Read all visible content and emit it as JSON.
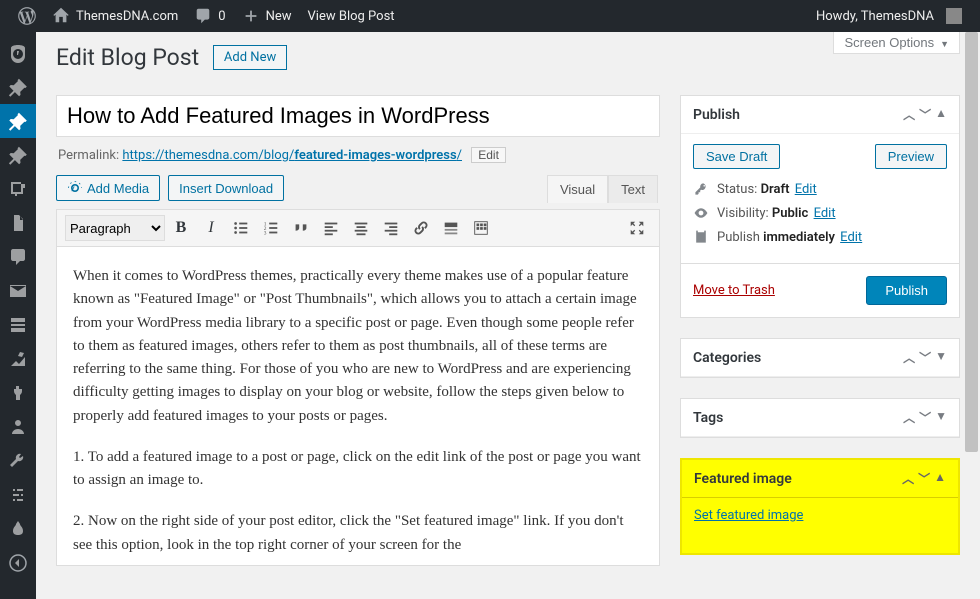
{
  "adminbar": {
    "site_title": "ThemesDNA.com",
    "comments_count": "0",
    "new_label": "New",
    "view_post": "View Blog Post",
    "howdy": "Howdy, ThemesDNA"
  },
  "page": {
    "heading": "Edit Blog Post",
    "add_new": "Add New",
    "screen_options": "Screen Options"
  },
  "title": {
    "value": "How to Add Featured Images in WordPress"
  },
  "permalink": {
    "label": "Permalink:",
    "base": "https://themesdna.com/blog/",
    "slug": "featured-images-wordpress",
    "edit": "Edit"
  },
  "media": {
    "add_media": "Add Media",
    "insert_download": "Insert Download"
  },
  "editor": {
    "tabs": {
      "visual": "Visual",
      "text": "Text"
    },
    "format": "Paragraph",
    "content_p1": "When it comes to WordPress themes, practically every theme makes use of a popular feature known as \"Featured Image\" or \"Post Thumbnails\", which allows you to attach a certain image from your WordPress media library to a specific post or page. Even though some people refer to them as featured images, others refer to them as post thumbnails, all of these terms are referring to the same thing. For those of you who are new to WordPress and are experiencing difficulty getting images to display on your blog or website, follow the steps given below to properly add featured images to your posts or pages.",
    "content_p2": "1. To add a featured image to a post or page, click on the edit link of the post or page you want to assign an image to.",
    "content_p3": "2. Now on the right side of your post editor, click the \"Set featured image\" link. If you don't see this option, look in the top right corner of your screen for the"
  },
  "publish": {
    "title": "Publish",
    "save_draft": "Save Draft",
    "preview": "Preview",
    "status_label": "Status:",
    "status_value": "Draft",
    "visibility_label": "Visibility:",
    "visibility_value": "Public",
    "schedule_label": "Publish",
    "schedule_value": "immediately",
    "edit": "Edit",
    "trash": "Move to Trash",
    "publish_btn": "Publish"
  },
  "categories": {
    "title": "Categories"
  },
  "tags": {
    "title": "Tags"
  },
  "featured": {
    "title": "Featured image",
    "set_link": "Set featured image"
  }
}
